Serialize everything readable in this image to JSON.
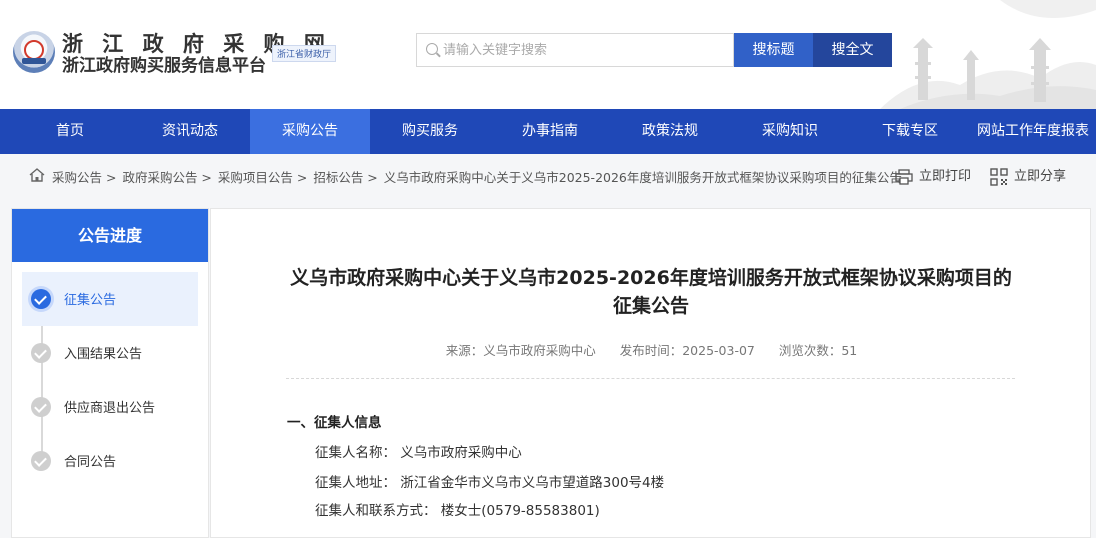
{
  "header": {
    "site_name": "浙 江 政 府 采 购 网",
    "site_subtitle": "浙江政府购买服务信息平台",
    "tag": "浙江省财政厅",
    "search_placeholder": "请输入关键字搜索",
    "btn_title": "搜标题",
    "btn_full": "搜全文"
  },
  "nav": {
    "items": [
      "首页",
      "资讯动态",
      "采购公告",
      "购买服务",
      "办事指南",
      "政策法规",
      "采购知识",
      "下载专区",
      "网站工作年度报表"
    ],
    "active_index": 2
  },
  "breadcrumb": {
    "items": [
      "采购公告 >",
      "政府采购公告 >",
      "采购项目公告 >",
      "招标公告 >",
      "义乌市政府采购中心关于义乌市2025-2026年度培训服务开放式框架协议采购项目的征集公告"
    ],
    "print": "立即打印",
    "share": "立即分享"
  },
  "sidebar": {
    "title": "公告进度",
    "steps": [
      "征集公告",
      "入围结果公告",
      "供应商退出公告",
      "合同公告"
    ],
    "active_index": 0
  },
  "article": {
    "title": "义乌市政府采购中心关于义乌市2025-2026年度培训服务开放式框架协议采购项目的征集公告",
    "source": "来源：义乌市政府采购中心",
    "published": "发布时间：2025-03-07",
    "views": "浏览次数：51",
    "section1": "一、征集人信息",
    "rows": [
      "征集人名称：  义乌市政府采购中心",
      "征集人地址：  浙江省金华市义乌市义乌市望道路300号4楼",
      "征集人和联系方式：  楼女士(0579-85583801)"
    ]
  },
  "colors": {
    "nav_bg": "#1f48b7",
    "nav_active": "#3b6fe0",
    "accent": "#2a6ae0"
  }
}
